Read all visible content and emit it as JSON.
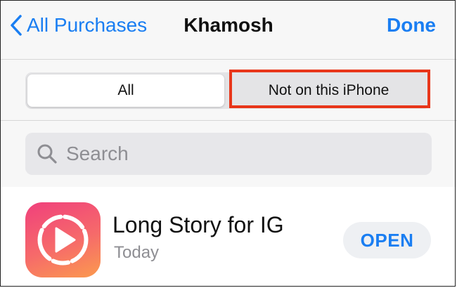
{
  "nav": {
    "back_label": "All Purchases",
    "title": "Khamosh",
    "done_label": "Done"
  },
  "segments": {
    "all_label": "All",
    "not_on_device_label": "Not on this iPhone",
    "selected": "All"
  },
  "search": {
    "placeholder": "Search",
    "value": ""
  },
  "apps": [
    {
      "name": "Long Story for IG",
      "date": "Today",
      "action_label": "OPEN",
      "icon": "play-circle-icon"
    }
  ],
  "colors": {
    "accent": "#1a7ef2",
    "highlight": "#e8361a",
    "icon_gradient": [
      "#f0407c",
      "#fb9a4e"
    ]
  }
}
